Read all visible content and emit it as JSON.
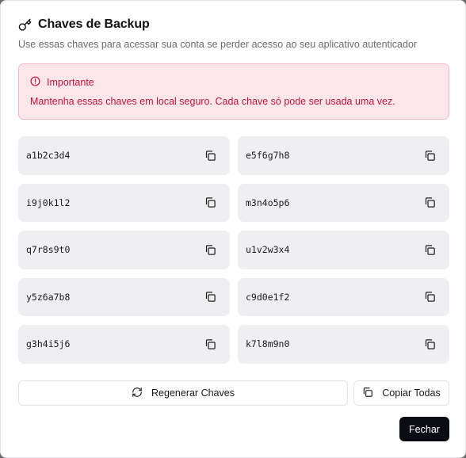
{
  "dialog": {
    "title": "Chaves de Backup",
    "title_icon": "key-icon",
    "subtitle": "Use essas chaves para acessar sua conta se perder acesso ao seu aplicativo autenticador"
  },
  "alert": {
    "icon": "alert-circle-icon",
    "heading": "Importante",
    "message": "Mantenha essas chaves em local seguro. Cada chave só pode ser usada uma vez.",
    "color": "#c2133e",
    "background": "#fde6ea"
  },
  "keys": [
    "a1b2c3d4",
    "e5f6g7h8",
    "i9j0k1l2",
    "m3n4o5p6",
    "q7r8s9t0",
    "u1v2w3x4",
    "y5z6a7b8",
    "c9d0e1f2",
    "g3h4i5j6",
    "k7l8m9n0"
  ],
  "copy_icon": "copy-icon",
  "actions": {
    "regenerate_label": "Regenerar Chaves",
    "regenerate_icon": "refresh-icon",
    "copy_all_label": "Copiar Todas",
    "copy_all_icon": "copy-icon",
    "close_label": "Fechar"
  },
  "colors": {
    "primary": "#0b0b14",
    "card": "#efeff2"
  }
}
